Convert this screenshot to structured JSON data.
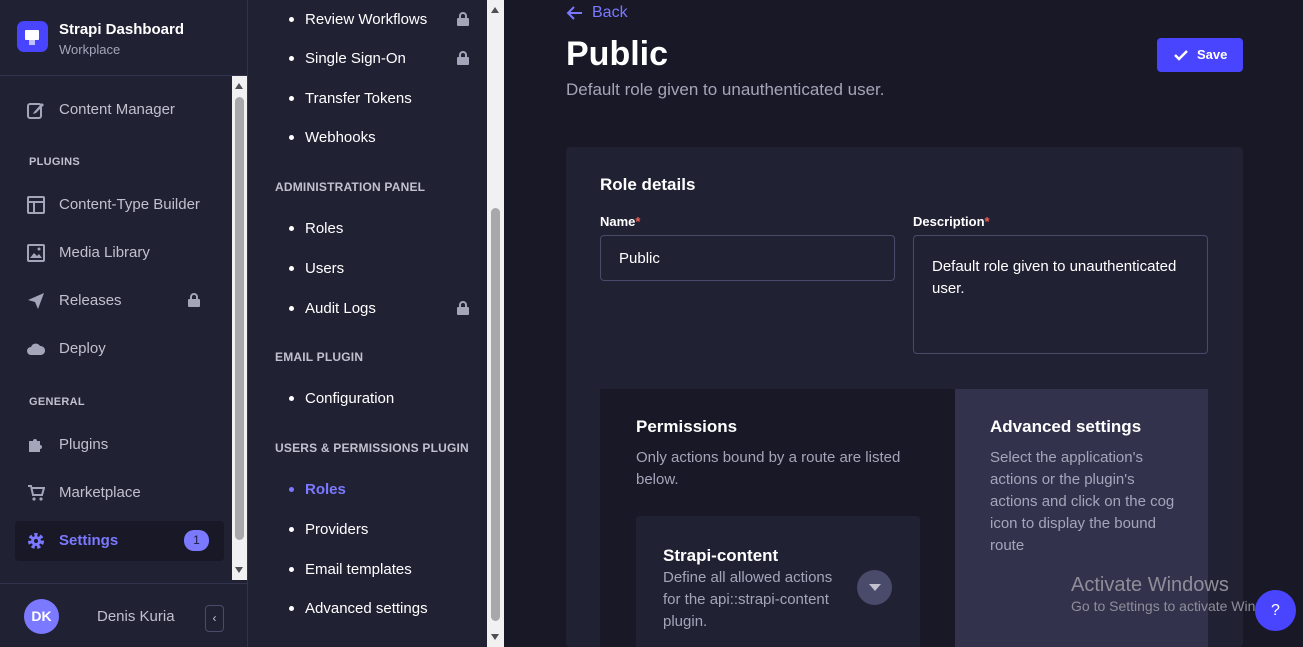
{
  "brand": {
    "title": "Strapi Dashboard",
    "subtitle": "Workplace"
  },
  "main_nav": {
    "content_manager": "Content Manager",
    "plugins_heading": "PLUGINS",
    "content_type_builder": "Content-Type Builder",
    "media_library": "Media Library",
    "releases": "Releases",
    "deploy": "Deploy",
    "general_heading": "GENERAL",
    "plugins": "Plugins",
    "marketplace": "Marketplace",
    "settings": "Settings",
    "settings_badge": "1"
  },
  "user": {
    "initials": "DK",
    "name": "Denis Kuria"
  },
  "settings_nav": {
    "review_workflows": "Review Workflows",
    "single_sign_on": "Single Sign-On",
    "transfer_tokens": "Transfer Tokens",
    "webhooks": "Webhooks",
    "admin_heading": "ADMINISTRATION PANEL",
    "roles": "Roles",
    "users": "Users",
    "audit_logs": "Audit Logs",
    "email_heading": "EMAIL PLUGIN",
    "configuration": "Configuration",
    "up_heading": "USERS & PERMISSIONS PLUGIN",
    "up_roles": "Roles",
    "providers": "Providers",
    "email_templates": "Email templates",
    "advanced_settings": "Advanced settings"
  },
  "header": {
    "back": "Back",
    "title": "Public",
    "subtitle": "Default role given to unauthenticated user.",
    "save": "Save"
  },
  "role_details": {
    "heading": "Role details",
    "name_label": "Name",
    "name_value": "Public",
    "description_label": "Description",
    "description_value": "Default role given to unauthenticated user.",
    "required_mark": "*"
  },
  "permissions": {
    "heading": "Permissions",
    "description": "Only actions bound by a route are listed below.",
    "accordion_title": "Strapi-content",
    "accordion_desc": "Define all allowed actions for the api::strapi-content plugin."
  },
  "advanced": {
    "heading": "Advanced settings",
    "description": "Select the application's actions or the plugin's actions and click on the cog icon to display the bound route"
  },
  "os_overlay": {
    "activate_title": "Activate Windows",
    "activate_sub": "Go to Settings to activate Windows.",
    "help": "?"
  },
  "colors": {
    "accent": "#4945ff",
    "accent_light": "#7b79ff",
    "background": "#181826",
    "panel": "#212134"
  }
}
